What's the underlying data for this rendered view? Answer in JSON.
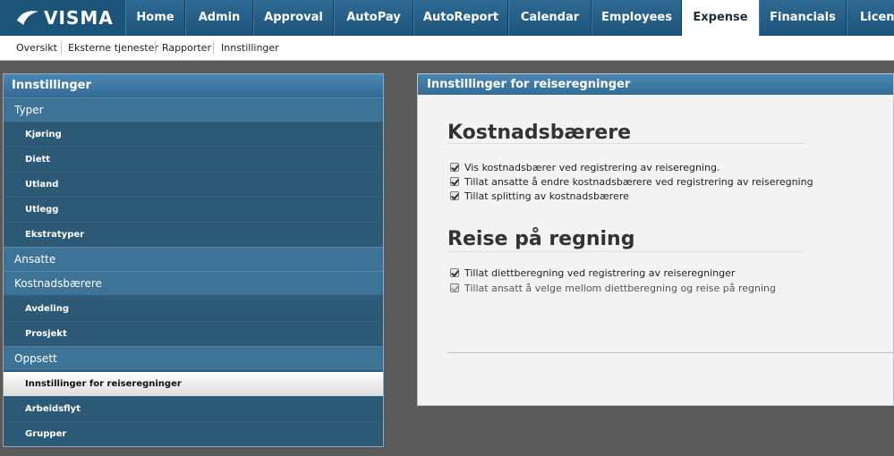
{
  "app": {
    "logo_text": "VISMA",
    "tabs": [
      {
        "label": "Home"
      },
      {
        "label": "Admin"
      },
      {
        "label": "Approval"
      },
      {
        "label": "AutoPay"
      },
      {
        "label": "AutoReport"
      },
      {
        "label": "Calendar"
      },
      {
        "label": "Employees"
      },
      {
        "label": "Expense",
        "active": true
      },
      {
        "label": "Financials"
      },
      {
        "label": "Licens"
      }
    ]
  },
  "subnav": {
    "items": [
      "Oversikt",
      "Eksterne tjenester",
      "Rapporter",
      "Innstillinger"
    ]
  },
  "sidebar": {
    "title": "Innstillinger",
    "items": [
      {
        "label": "Typer",
        "kind": "section"
      },
      {
        "label": "Kjøring",
        "kind": "sub"
      },
      {
        "label": "Diett",
        "kind": "sub"
      },
      {
        "label": "Utland",
        "kind": "sub"
      },
      {
        "label": "Utlegg",
        "kind": "sub"
      },
      {
        "label": "Ekstratyper",
        "kind": "sub"
      },
      {
        "label": "Ansatte",
        "kind": "section"
      },
      {
        "label": "Kostnadsbærere",
        "kind": "section"
      },
      {
        "label": "Avdeling",
        "kind": "sub"
      },
      {
        "label": "Prosjekt",
        "kind": "sub"
      },
      {
        "label": "Oppsett",
        "kind": "section"
      },
      {
        "label": "Innstillinger for reiseregninger",
        "kind": "sub",
        "selected": true
      },
      {
        "label": "Arbeidsflyt",
        "kind": "sub"
      },
      {
        "label": "Grupper",
        "kind": "sub"
      }
    ]
  },
  "main": {
    "title": "Innstillinger for reiseregninger",
    "sections": [
      {
        "heading": "Kostnadsbærere",
        "options": [
          {
            "label": "Vis kostnadsbærer ved registrering av reiseregning.",
            "checked": true,
            "disabled": false
          },
          {
            "label": "Tillat ansatte å endre kostnadsbærere ved registrering av reiseregning",
            "checked": true,
            "disabled": false
          },
          {
            "label": "Tillat splitting av kostnadsbærere",
            "checked": true,
            "disabled": false
          }
        ]
      },
      {
        "heading": "Reise på regning",
        "options": [
          {
            "label": "Tillat diettberegning ved registrering av reiseregninger",
            "checked": true,
            "disabled": false
          },
          {
            "label": "Tillat ansatt å velge mellom diettberegning og reise på regning",
            "checked": true,
            "disabled": true
          }
        ]
      }
    ]
  },
  "colors": {
    "nav_bg": "#1c5378",
    "panel_header": "#3f7ba5",
    "sidebar_bg": "#2c5a76",
    "section_bg": "#3d7397",
    "page_bg": "#5a5a5a"
  }
}
